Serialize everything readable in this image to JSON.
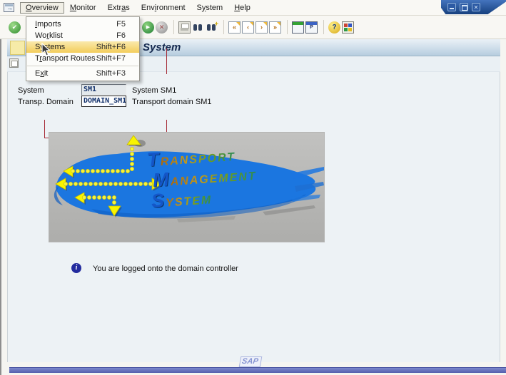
{
  "window": {
    "controls": [
      {
        "name": "minimize-icon",
        "glyph": ""
      },
      {
        "name": "maximize-icon",
        "glyph": ""
      },
      {
        "name": "close-icon",
        "glyph": "✕"
      }
    ]
  },
  "menubar": {
    "items": [
      {
        "id": "overview",
        "pre": "",
        "accel": "O",
        "post": "verview",
        "active": true
      },
      {
        "id": "monitor",
        "pre": "",
        "accel": "M",
        "post": "onitor"
      },
      {
        "id": "extras",
        "pre": "Extr",
        "accel": "a",
        "post": "s"
      },
      {
        "id": "environment",
        "pre": "Env",
        "accel": "i",
        "post": "ronment"
      },
      {
        "id": "system",
        "pre": "S",
        "accel": "y",
        "post": "stem"
      },
      {
        "id": "help",
        "pre": "",
        "accel": "H",
        "post": "elp"
      }
    ]
  },
  "context_menu": {
    "items": [
      {
        "id": "imports",
        "pre": "",
        "accel": "I",
        "post": "mports",
        "shortcut": "F5"
      },
      {
        "id": "worklist",
        "pre": "Wo",
        "accel": "r",
        "post": "klist",
        "shortcut": "F6"
      },
      {
        "id": "systems",
        "pre": "Sys",
        "accel": "t",
        "post": "ems",
        "shortcut": "Shift+F6",
        "highlighted": true
      },
      {
        "id": "transport-routes",
        "pre": "T",
        "accel": "r",
        "post": "ansport Routes",
        "shortcut": "Shift+F7",
        "separator_after": true
      },
      {
        "id": "exit",
        "pre": "E",
        "accel": "x",
        "post": "it",
        "shortcut": "Shift+F3"
      }
    ]
  },
  "toolbar": {
    "icons": [
      {
        "name": "enter-icon",
        "type": "circle-green",
        "glyph": "✔"
      },
      {
        "name": "continue-icon",
        "type": "circle-green2",
        "glyph": "▶"
      },
      {
        "name": "cancel-icon",
        "type": "circle-gray",
        "glyph": "✕"
      },
      {
        "name": "sep"
      },
      {
        "name": "print-icon",
        "type": "printer",
        "glyph": ""
      },
      {
        "name": "find-icon",
        "type": "binoculars",
        "glyph": ""
      },
      {
        "name": "find-next-icon",
        "type": "binoculars-plus",
        "glyph": "+"
      },
      {
        "name": "sep"
      },
      {
        "name": "first-page-icon",
        "type": "page",
        "glyph": "«"
      },
      {
        "name": "previous-page-icon",
        "type": "page",
        "glyph": "‹"
      },
      {
        "name": "next-page-icon",
        "type": "page",
        "glyph": "›"
      },
      {
        "name": "last-page-icon",
        "type": "page",
        "glyph": "»"
      },
      {
        "name": "sep"
      },
      {
        "name": "new-session-icon",
        "type": "window-green",
        "glyph": ""
      },
      {
        "name": "shortcut-icon",
        "type": "window-blue",
        "glyph": "P"
      },
      {
        "name": "sep"
      },
      {
        "name": "help-icon",
        "type": "circle-yellow",
        "glyph": "?"
      },
      {
        "name": "customize-icon",
        "type": "grid",
        "glyph": ""
      }
    ]
  },
  "screen_title": "System",
  "form": {
    "fields": [
      {
        "label": "System",
        "value": "SM1",
        "description": "System SM1"
      },
      {
        "label": "Transp. Domain",
        "value": "DOMAIN_SM1",
        "description": "Transport domain SM1"
      }
    ]
  },
  "tms_logo": {
    "words": [
      {
        "initial": "T",
        "rest": "RANSPORT"
      },
      {
        "initial": "M",
        "rest": "ANAGEMENT"
      },
      {
        "initial": "S",
        "rest": "YSTEM"
      }
    ]
  },
  "status_message": {
    "icon": "info-icon",
    "text": "You are logged onto the domain controller"
  },
  "footer": {
    "brand": "SAP"
  },
  "colors": {
    "menu_highlight": "#f3cd5b",
    "titlebar_top": "#eaf1f7",
    "titlebar_bottom": "#b6cddf",
    "bottom_bar": "#6570b8",
    "annotation_red": "#a52a35",
    "brush_blue": "#1b76e0",
    "arrow_yellow": "#f6f23a"
  }
}
